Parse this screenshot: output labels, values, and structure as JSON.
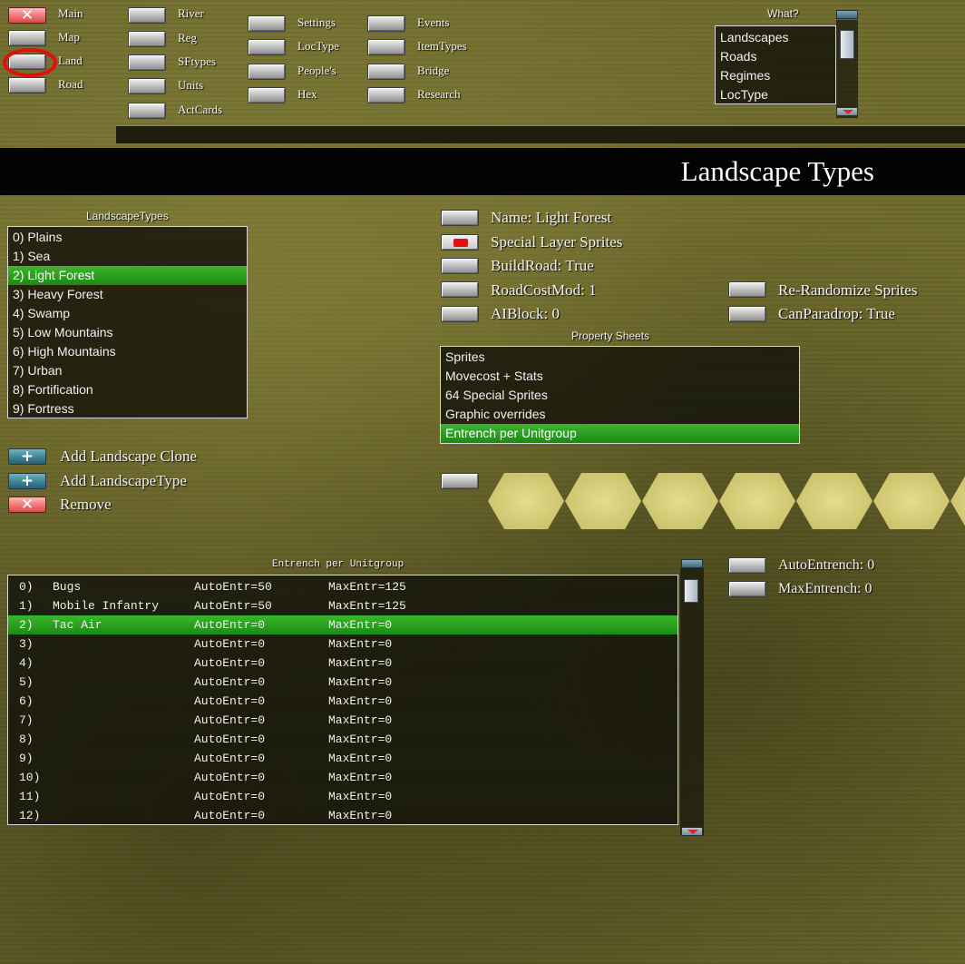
{
  "top_nav": {
    "col1": [
      {
        "label": "Main",
        "icon": "close-icon"
      },
      {
        "label": "Map"
      },
      {
        "label": "Land",
        "circled": true
      },
      {
        "label": "Road"
      }
    ],
    "col2": [
      "River",
      "Reg",
      "SFtypes",
      "Units",
      "ActCards"
    ],
    "col3": [
      "Settings",
      "LocType",
      "People's",
      "Hex"
    ],
    "col4": [
      "Events",
      "ItemTypes",
      "Bridge",
      "Research"
    ]
  },
  "what_box": {
    "caption": "What?",
    "items": [
      "Landscapes",
      "Roads",
      "Regimes",
      "LocType"
    ]
  },
  "page_title": "Landscape Types",
  "landscape_list": {
    "caption": "LandscapeTypes",
    "items": [
      "0) Plains",
      "1) Sea",
      "2) Light Forest",
      "3) Heavy Forest",
      "4) Swamp",
      "5) Low Mountains",
      "6) High Mountains",
      "7) Urban",
      "8) Fortification",
      "9) Fortress"
    ],
    "selected_index": 2
  },
  "properties": {
    "name": "Name: Light Forest",
    "special_layer": "Special Layer Sprites",
    "build_road": "BuildRoad: True",
    "road_cost_mod": "RoadCostMod:  1",
    "ai_block": "AIBlock:  0",
    "re_randomize": "Re-Randomize Sprites",
    "can_paradrop": "CanParadrop: True"
  },
  "property_sheets": {
    "caption": "Property Sheets",
    "items": [
      "Sprites",
      "Movecost + Stats",
      "64 Special Sprites",
      "Graphic overrides",
      "Entrench per Unitgroup"
    ],
    "selected_index": 4
  },
  "actions": {
    "add_clone": "Add Landscape Clone",
    "add_type": "Add LandscapeType",
    "remove": "Remove"
  },
  "entrench": {
    "caption": "Entrench per Unitgroup",
    "rows": [
      {
        "id": "0)",
        "name": "Bugs",
        "auto": "AutoEntr=50",
        "max": "MaxEntr=125"
      },
      {
        "id": "1)",
        "name": "Mobile Infantry",
        "auto": "AutoEntr=50",
        "max": "MaxEntr=125"
      },
      {
        "id": "2)",
        "name": "Tac Air",
        "auto": "AutoEntr=0",
        "max": "MaxEntr=0"
      },
      {
        "id": "3)",
        "name": "",
        "auto": "AutoEntr=0",
        "max": "MaxEntr=0"
      },
      {
        "id": "4)",
        "name": "",
        "auto": "AutoEntr=0",
        "max": "MaxEntr=0"
      },
      {
        "id": "5)",
        "name": "",
        "auto": "AutoEntr=0",
        "max": "MaxEntr=0"
      },
      {
        "id": "6)",
        "name": "",
        "auto": "AutoEntr=0",
        "max": "MaxEntr=0"
      },
      {
        "id": "7)",
        "name": "",
        "auto": "AutoEntr=0",
        "max": "MaxEntr=0"
      },
      {
        "id": "8)",
        "name": "",
        "auto": "AutoEntr=0",
        "max": "MaxEntr=0"
      },
      {
        "id": "9)",
        "name": "",
        "auto": "AutoEntr=0",
        "max": "MaxEntr=0"
      },
      {
        "id": "10)",
        "name": "",
        "auto": "AutoEntr=0",
        "max": "MaxEntr=0"
      },
      {
        "id": "11)",
        "name": "",
        "auto": "AutoEntr=0",
        "max": "MaxEntr=0"
      },
      {
        "id": "12)",
        "name": "",
        "auto": "AutoEntr=0",
        "max": "MaxEntr=0"
      }
    ],
    "selected_index": 2,
    "auto_label": "AutoEntrench: 0",
    "max_label": "MaxEntrench: 0"
  },
  "colors": {
    "selection_green": "#22a01a",
    "remove_red": "#e05555",
    "add_teal": "#3b7f90",
    "circle_red": "#e01010"
  }
}
